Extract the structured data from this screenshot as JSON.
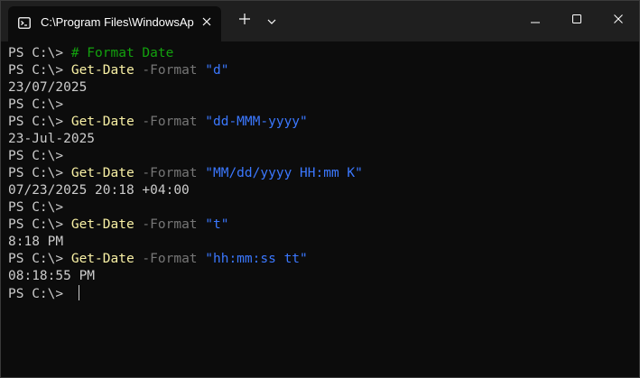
{
  "tab": {
    "title": "C:\\Program Files\\WindowsAp",
    "icon": "terminal-icon"
  },
  "titlebar_buttons": {
    "new_tab_icon": "plus-icon",
    "dropdown_icon": "chevron-down-icon",
    "minimize_icon": "minimize-icon",
    "maximize_icon": "maximize-icon",
    "close_icon": "close-icon"
  },
  "colors": {
    "background": "#0c0c0c",
    "titlebar": "#1f1f1f",
    "text": "#cccccc",
    "command": "#f9f1a5",
    "parameter": "#767676",
    "string": "#3b78ff",
    "comment": "#13a10e"
  },
  "terminal": {
    "prompt": "PS C:\\> ",
    "lines": [
      {
        "comment": "# Format Date"
      },
      {
        "cmd": "Get-Date",
        "param": " -Format ",
        "str": "\"d\""
      },
      {
        "output": "23/07/2025"
      },
      {
        "empty_prompt": true
      },
      {
        "cmd": "Get-Date",
        "param": " -Format ",
        "str": "\"dd-MMM-yyyy\""
      },
      {
        "output": "23-Jul-2025"
      },
      {
        "empty_prompt": true
      },
      {
        "cmd": "Get-Date",
        "param": " -Format ",
        "str": "\"MM/dd/yyyy HH:mm K\""
      },
      {
        "output": "07/23/2025 20:18 +04:00"
      },
      {
        "empty_prompt": true
      },
      {
        "cmd": "Get-Date",
        "param": " -Format ",
        "str": "\"t\""
      },
      {
        "output": "8:18 PM"
      },
      {
        "cmd": "Get-Date",
        "param": " -Format ",
        "str": "\"hh:mm:ss tt\""
      },
      {
        "output": "08:18:55 PM"
      },
      {
        "empty_prompt": true,
        "cursor": true
      }
    ]
  }
}
